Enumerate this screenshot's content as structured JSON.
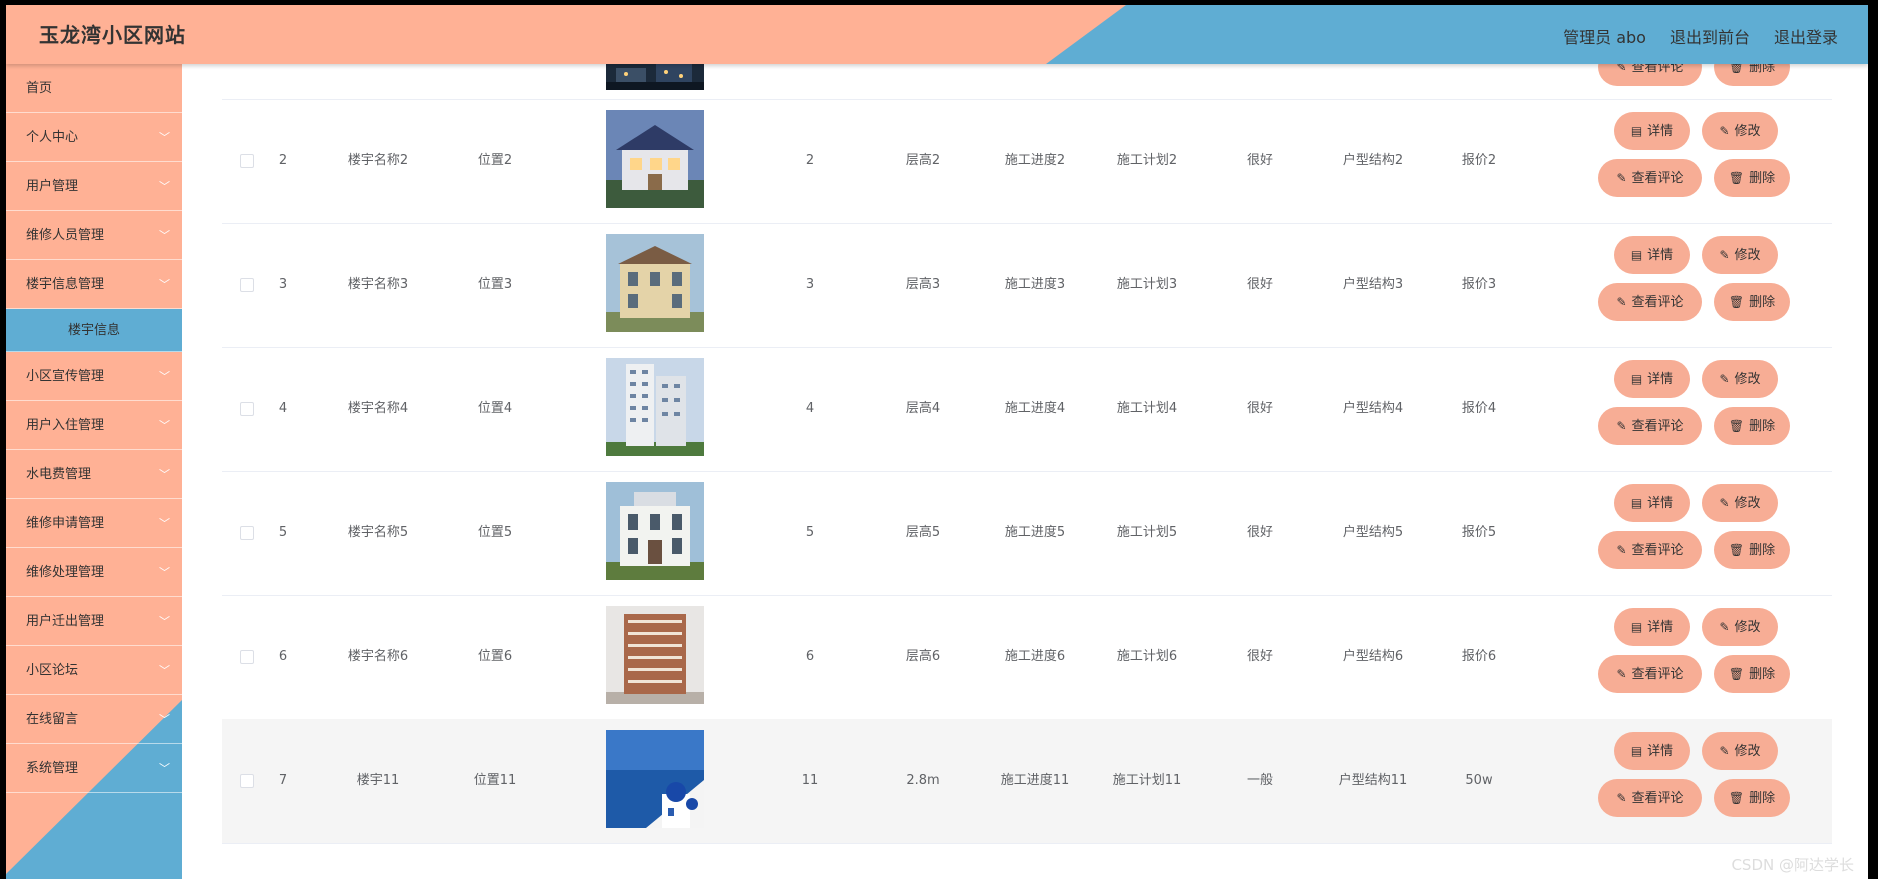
{
  "header": {
    "site_title": "玉龙湾小区网站",
    "admin_label": "管理员 abo",
    "back_label": "退出到前台",
    "logout_label": "退出登录"
  },
  "sidebar": {
    "items": [
      {
        "label": "首页",
        "has_chevron": false
      },
      {
        "label": "个人中心",
        "has_chevron": true
      },
      {
        "label": "用户管理",
        "has_chevron": true
      },
      {
        "label": "维修人员管理",
        "has_chevron": true
      },
      {
        "label": "楼宇信息管理",
        "has_chevron": true
      },
      {
        "label": "楼宇信息",
        "sub": true
      },
      {
        "label": "小区宣传管理",
        "has_chevron": true
      },
      {
        "label": "用户入住管理",
        "has_chevron": true
      },
      {
        "label": "水电费管理",
        "has_chevron": true
      },
      {
        "label": "维修申请管理",
        "has_chevron": true
      },
      {
        "label": "维修处理管理",
        "has_chevron": true
      },
      {
        "label": "用户迁出管理",
        "has_chevron": true
      },
      {
        "label": "小区论坛",
        "has_chevron": true
      },
      {
        "label": "在线留言",
        "has_chevron": true
      },
      {
        "label": "系统管理",
        "has_chevron": true
      }
    ]
  },
  "buttons": {
    "detail": "详情",
    "edit": "修改",
    "comments": "查看评论",
    "delete": "删除"
  },
  "rows": [
    {
      "index": "2",
      "name": "楼宇名称2",
      "location": "位置2",
      "floors": "2",
      "height": "层高2",
      "progress": "施工进度2",
      "plan": "施工计划2",
      "quality": "很好",
      "layout": "户型结构2",
      "price": "报价2",
      "img": "villa-blue"
    },
    {
      "index": "3",
      "name": "楼宇名称3",
      "location": "位置3",
      "floors": "3",
      "height": "层高3",
      "progress": "施工进度3",
      "plan": "施工计划3",
      "quality": "很好",
      "layout": "户型结构3",
      "price": "报价3",
      "img": "villa-yellow"
    },
    {
      "index": "4",
      "name": "楼宇名称4",
      "location": "位置4",
      "floors": "4",
      "height": "层高4",
      "progress": "施工进度4",
      "plan": "施工计划4",
      "quality": "很好",
      "layout": "户型结构4",
      "price": "报价4",
      "img": "tower"
    },
    {
      "index": "5",
      "name": "楼宇名称5",
      "location": "位置5",
      "floors": "5",
      "height": "层高5",
      "progress": "施工进度5",
      "plan": "施工计划5",
      "quality": "很好",
      "layout": "户型结构5",
      "price": "报价5",
      "img": "villa-white"
    },
    {
      "index": "6",
      "name": "楼宇名称6",
      "location": "位置6",
      "floors": "6",
      "height": "层高6",
      "progress": "施工进度6",
      "plan": "施工计划6",
      "quality": "很好",
      "layout": "户型结构6",
      "price": "报价6",
      "img": "apartment"
    },
    {
      "index": "7",
      "name": "楼宇11",
      "location": "位置11",
      "floors": "11",
      "height": "2.8m",
      "progress": "施工进度11",
      "plan": "施工计划11",
      "quality": "一般",
      "layout": "户型结构11",
      "price": "50w",
      "img": "santorini"
    }
  ],
  "watermark": "CSDN @阿达学长",
  "colors": {
    "salmon": "#ffb195",
    "blue": "#5fadd3",
    "button": "#f7ad95"
  }
}
